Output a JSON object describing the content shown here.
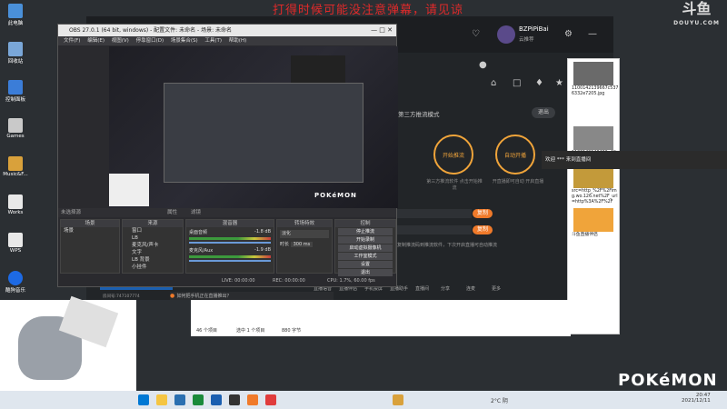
{
  "danmaku_text": "打得时候可能没注意弹幕，请见谅",
  "douyu": {
    "logo": "斗鱼",
    "sub": "DOUYU.COM"
  },
  "desktop_icons": [
    {
      "label": "此电脑",
      "color": "#4a90d9"
    },
    {
      "label": "回收站",
      "color": "#7aa7d8"
    },
    {
      "label": "控制面板",
      "color": "#3b7dd8"
    },
    {
      "label": "Games",
      "color": "#c9c9c9"
    },
    {
      "label": "Music&F...",
      "color": "#d9a13b"
    },
    {
      "label": "Works",
      "color": "#e8e8e8"
    },
    {
      "label": "WPS",
      "color": "#e8e8e8"
    },
    {
      "label": "酷狗音乐",
      "color": "#1d6ae5"
    }
  ],
  "app": {
    "username": "BZPiPiBai",
    "username_sub": "云推荐",
    "step_title": "第三方推流模式",
    "step_tag": "退出",
    "bubbles": [
      {
        "label": "开始推流",
        "num": "2",
        "desc": "第三方推流软件\n点击开始推流"
      },
      {
        "label": "自动开播",
        "num": "4",
        "desc": "开直播即可自动\n开启直播"
      }
    ],
    "copy_btn": "复制",
    "notice": "复制推流码到推流软件，下次开启直播可自动推流",
    "game_banner": "正在游戏中",
    "bottom_items": [
      "直播语音",
      "直播伴侣",
      "手机投屏",
      "直播助手",
      "直播间",
      "分享",
      "连麦",
      "更多"
    ],
    "room": "房间号:747107774",
    "help": "如何把手机正在直播推出？"
  },
  "obs": {
    "title": "OBS 27.0.1 (64 bit, windows) - 配置文件: 未命名 - 场景: 未命名",
    "menu": [
      "文件(F)",
      "编辑(E)",
      "视图(V)",
      "停靠窗口(D)",
      "场景集合(S)",
      "工具(T)",
      "帮助(H)"
    ],
    "preview_logo": "POKéMON",
    "selected": "未选择源",
    "props": "属性",
    "filters": "滤镜",
    "panels": {
      "scenes": "场景",
      "sources": "来源",
      "mixer": "混音器",
      "transitions": "转场特效",
      "controls": "控制"
    },
    "scene_items": [
      "场景"
    ],
    "source_items": [
      "窗口",
      "LB",
      "麦克风/声卡",
      "文字",
      "LB 背景",
      "小挂件"
    ],
    "mixer_items": [
      {
        "name": "桌面音频",
        "db": "-1.8 dB"
      },
      {
        "name": "麦克风/Aux",
        "db": "-1.9 dB"
      }
    ],
    "transition": "淡化",
    "duration_label": "时长",
    "duration": "300 ms",
    "controls": [
      "停止推流",
      "开始录制",
      "启动虚拟摄像机",
      "工作室模式",
      "设置",
      "退出"
    ],
    "status": {
      "live": "LIVE: 00:00:00",
      "rec": "REC: 00:00:00",
      "cpu": "CPU: 1.7%, 60.00 fps"
    }
  },
  "chat": [
    {
      "caption": "1100142139667c5376332e7205.jpg",
      "color": "#6a6a6a"
    },
    {
      "caption": "1100142140402e4fb1933a481.jpg",
      "color": "#888"
    },
    {
      "caption": "src=http_%2F%2Fimg.wo.126.net%2F_url=http%3A%2F%2F",
      "color": "#c39a3a"
    },
    {
      "caption": "斗鱼直播伴侣",
      "color": "#f0a43a"
    }
  ],
  "tooltip": "欢迎 *** 来到直播间",
  "explorer": {
    "count": "46 个项目",
    "selected": "选中 1 个项目",
    "size": "880 字节"
  },
  "watermark": "POKéMON",
  "taskbar": {
    "temp": "2°C 阴",
    "time": "20:47",
    "date": "2021/12/11"
  }
}
